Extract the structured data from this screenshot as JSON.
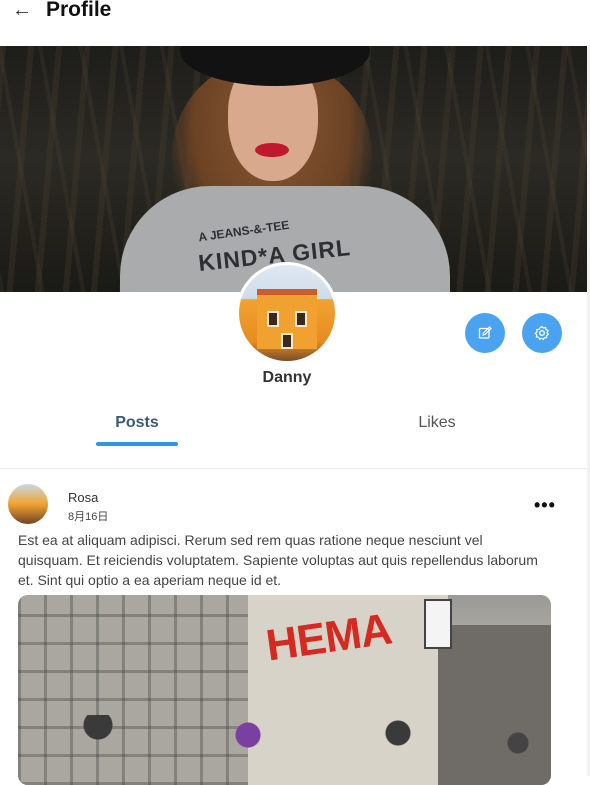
{
  "header": {
    "title": "Profile",
    "back_icon": "arrow-left-icon"
  },
  "cover": {
    "shirt_line1": "A JEANS-&-TEE",
    "shirt_line2": "KIND*A GIRL"
  },
  "profile": {
    "username": "Danny",
    "avatar_icon": "avatar-photo",
    "edit_icon": "edit-icon",
    "settings_icon": "gear-icon",
    "accent_color": "#4aa3f0"
  },
  "tabs": [
    {
      "label": "Posts",
      "active": true
    },
    {
      "label": "Likes",
      "active": false
    }
  ],
  "post": {
    "author": "Rosa",
    "date": "8月16日",
    "more_icon": "more-horizontal-icon",
    "text": "Est ea at aliquam adipisci. Rerum sed rem quas ratione neque nesciunt vel quisquam. Et reiciendis voluptatem. Sapiente voluptas aut quis repellendus laborum et. Sint qui optio a ea aperiam neque id et.",
    "image_sign": "HEMA"
  }
}
